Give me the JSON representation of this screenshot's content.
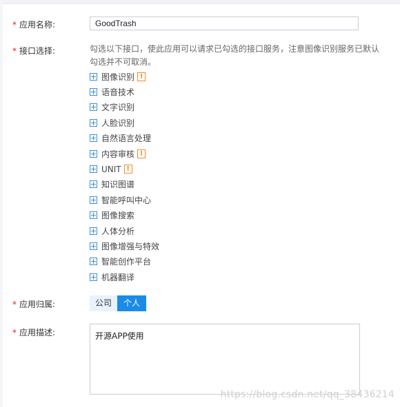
{
  "form": {
    "app_name": {
      "label": "应用名称:",
      "value": "GoodTrash"
    },
    "api_select": {
      "label": "接口选择:",
      "hint": "勾选以下接口，使此应用可以请求已勾选的接口服务，注意图像识别服务已默认勾选并不可取消。",
      "items": [
        {
          "label": "图像识别",
          "badge": "!"
        },
        {
          "label": "语音技术"
        },
        {
          "label": "文字识别"
        },
        {
          "label": "人脸识别"
        },
        {
          "label": "自然语言处理"
        },
        {
          "label": "内容审核",
          "badge": "!"
        },
        {
          "label": "UNIT",
          "badge": "!"
        },
        {
          "label": "知识图谱"
        },
        {
          "label": "智能呼叫中心"
        },
        {
          "label": "图像搜索"
        },
        {
          "label": "人体分析"
        },
        {
          "label": "图像增强与特效"
        },
        {
          "label": "智能创作平台"
        },
        {
          "label": "机器翻译"
        }
      ]
    },
    "ownership": {
      "label": "应用归属:",
      "options": [
        "公司",
        "个人"
      ],
      "selected": "个人"
    },
    "description": {
      "label": "应用描述:",
      "value": "开源APP使用"
    },
    "required_mark": "*"
  },
  "watermark": "https://blog.csdn.net/qq_38436214",
  "colors": {
    "accent": "#1a8be8",
    "warning": "#f08a24",
    "required": "#e02020"
  }
}
